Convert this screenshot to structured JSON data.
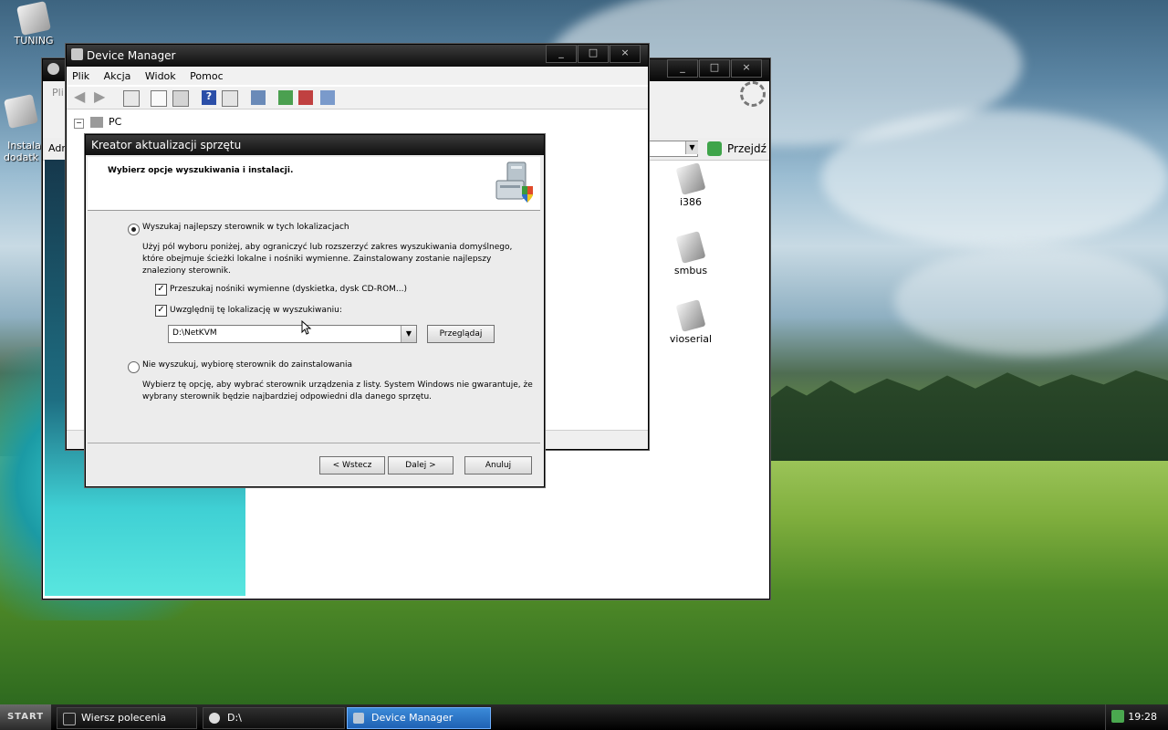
{
  "desktop": {
    "icons": [
      {
        "label": "TUNING"
      },
      {
        "label": "Instala\ndodatk"
      }
    ]
  },
  "explorer": {
    "menu_partial": "Pli",
    "addr_partial": "Adr",
    "go_label": "Przejdź",
    "folders": [
      {
        "label": "i386"
      },
      {
        "label": "smbus"
      },
      {
        "label": "vioserial"
      }
    ]
  },
  "device_manager": {
    "title": "Device Manager",
    "menu": [
      "Plik",
      "Akcja",
      "Widok",
      "Pomoc"
    ],
    "tree_root": "PC"
  },
  "wizard": {
    "title": "Kreator aktualizacji sprzętu",
    "heading": "Wybierz opcje wyszukiwania i instalacji.",
    "option1": {
      "label": "Wyszukaj najlepszy sterownik w tych lokalizacjach",
      "selected": true,
      "description": "Użyj pól wyboru poniżej, aby ograniczyć lub rozszerzyć zakres wyszukiwania domyślnego, które obejmuje ścieżki lokalne i nośniki wymienne. Zainstalowany zostanie najlepszy znaleziony sterownik."
    },
    "check1": {
      "label": "Przeszukaj nośniki wymienne (dyskietka, dysk CD-ROM...)",
      "checked": true
    },
    "check2": {
      "label": "Uwzględnij tę lokalizację w wyszukiwaniu:",
      "checked": true
    },
    "path_value": "D:\\NetKVM",
    "browse_label": "Przeglądaj",
    "option2": {
      "label": "Nie wyszukuj, wybiorę sterownik do zainstalowania",
      "selected": false,
      "description": "Wybierz tę opcję, aby wybrać sterownik urządzenia z listy. System Windows nie gwarantuje, że wybrany sterownik będzie najbardziej odpowiedni dla danego sprzętu."
    },
    "back_label": "< Wstecz",
    "next_label": "Dalej >",
    "cancel_label": "Anuluj"
  },
  "taskbar": {
    "start_label": "START",
    "tasks": [
      {
        "label": "Wiersz polecenia",
        "active": false
      },
      {
        "label": "D:\\",
        "active": false
      },
      {
        "label": "Device Manager",
        "active": true
      }
    ],
    "clock": "19:28"
  },
  "colors": {
    "active_task": "#2f7bd0",
    "titlebar": "#0e0e0e"
  }
}
